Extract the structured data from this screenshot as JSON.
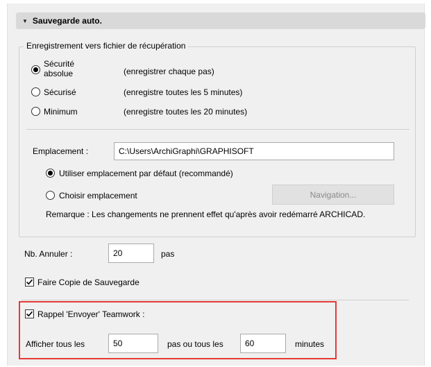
{
  "section": {
    "title": "Sauvegarde auto."
  },
  "recovery": {
    "legend": "Enregistrement vers fichier de récupération",
    "options": [
      {
        "label_line1": "Sécurité",
        "label_line2": "absolue",
        "desc": "(enregistrer chaque pas)",
        "selected": true
      },
      {
        "label": "Sécurisé",
        "desc": "(enregistre toutes les 5 minutes)",
        "selected": false
      },
      {
        "label": "Minimum",
        "desc": "(enregistre toutes les 20 minutes)",
        "selected": false
      }
    ]
  },
  "location": {
    "label": "Emplacement :",
    "path": "C:\\Users\\ArchiGraphi\\GRAPHISOFT",
    "default_option": "Utiliser emplacement par défaut (recommandé)",
    "custom_option": "Choisir emplacement",
    "browse_button": "Navigation...",
    "note": "Remarque : Les changements ne prennent effet qu'après avoir redémarré ARCHICAD."
  },
  "undo": {
    "label": "Nb. Annuler :",
    "value": "20",
    "unit": "pas"
  },
  "backup": {
    "label": "Faire Copie de Sauvegarde",
    "checked": true
  },
  "teamwork": {
    "label": "Rappel 'Envoyer' Teamwork :",
    "checked": true,
    "show_every_label": "Afficher tous les",
    "steps_value": "50",
    "or_label": "pas ou tous les",
    "minutes_value": "60",
    "minutes_label": "minutes"
  }
}
